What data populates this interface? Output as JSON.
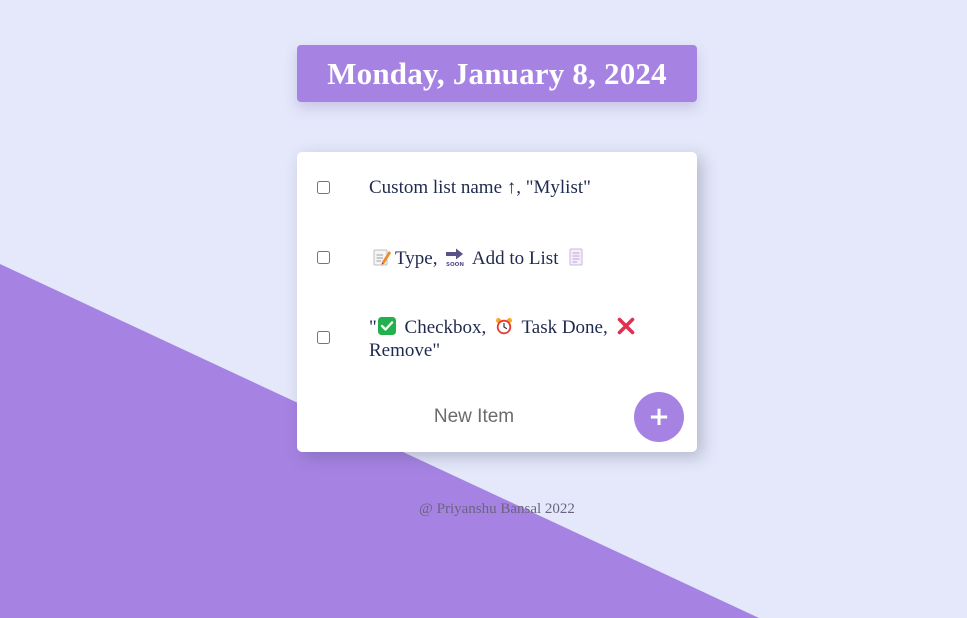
{
  "colors": {
    "page_background": "#e4e8fa",
    "accent": "#a683e3",
    "text": "#1f2a4e"
  },
  "heading": {
    "date": "Monday, January 8, 2024"
  },
  "list": {
    "items": [
      {
        "checked": false,
        "text": "Custom list name ↑, \"Mylist\""
      },
      {
        "checked": false,
        "parts": [
          "Type,",
          "Add to List"
        ],
        "icons": [
          "memo-icon",
          "soon-arrow-icon",
          "scroll-icon"
        ]
      },
      {
        "checked": false,
        "parts": [
          "\"",
          "Checkbox,",
          "Task Done,",
          "Remove\""
        ],
        "icons": [
          "check-mark-icon",
          "alarm-clock-icon",
          "cross-mark-icon"
        ]
      }
    ],
    "new_item_placeholder": "New Item",
    "add_button_label": "+"
  },
  "footer": {
    "text": "@ Priyanshu Bansal 2022"
  }
}
